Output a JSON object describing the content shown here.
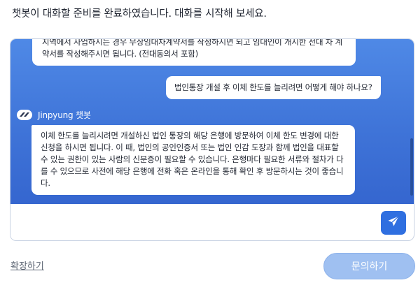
{
  "status_message": "챗봇이 대화할 준비를 완료하였습니다. 대화를 시작해 보세요.",
  "chat": {
    "previous_bot_text": "지역에서 사업하시는 경우 무상임대차계약서를 작성하시면 되고 임대인이 개시한 전대 차 계약서를 작성해주시면 됩니다. (전대동의서 포함)",
    "user_message": "법인통장 개설 후 이체 한도를 늘리려면 어떻게 해야 하나요?",
    "bot_name": "Jinpyung 챗봇",
    "bot_message": "이체 한도를 늘리시려면 개설하신 법인 통장의 해당 은행에 방문하여 이체 한도 변경에 대한 신청을 하시면 됩니다. 이 때, 법인의 공인인증서 또는 법인 인감 도장과 함께 법인을 대표할 수 있는 권한이 있는 사람의 신분증이 필요할 수 있습니다. 은행마다 필요한 서류와 절차가 다를 수 있으므로 사전에 해당 은행에 전화 혹은 온라인을 통해 확인 후 방문하시는 것이 좋습니다."
  },
  "input": {
    "value": "",
    "placeholder": ""
  },
  "icons": {
    "send": "paper-plane-icon",
    "bot_avatar": "jinpyung-logo-icon"
  },
  "footer": {
    "expand_label": "확장하기",
    "inquire_label": "문의하기"
  },
  "colors": {
    "chat_background": "#3f74d8",
    "send_button": "#2f6fe0",
    "inquire_button": "#9fc0f1"
  }
}
